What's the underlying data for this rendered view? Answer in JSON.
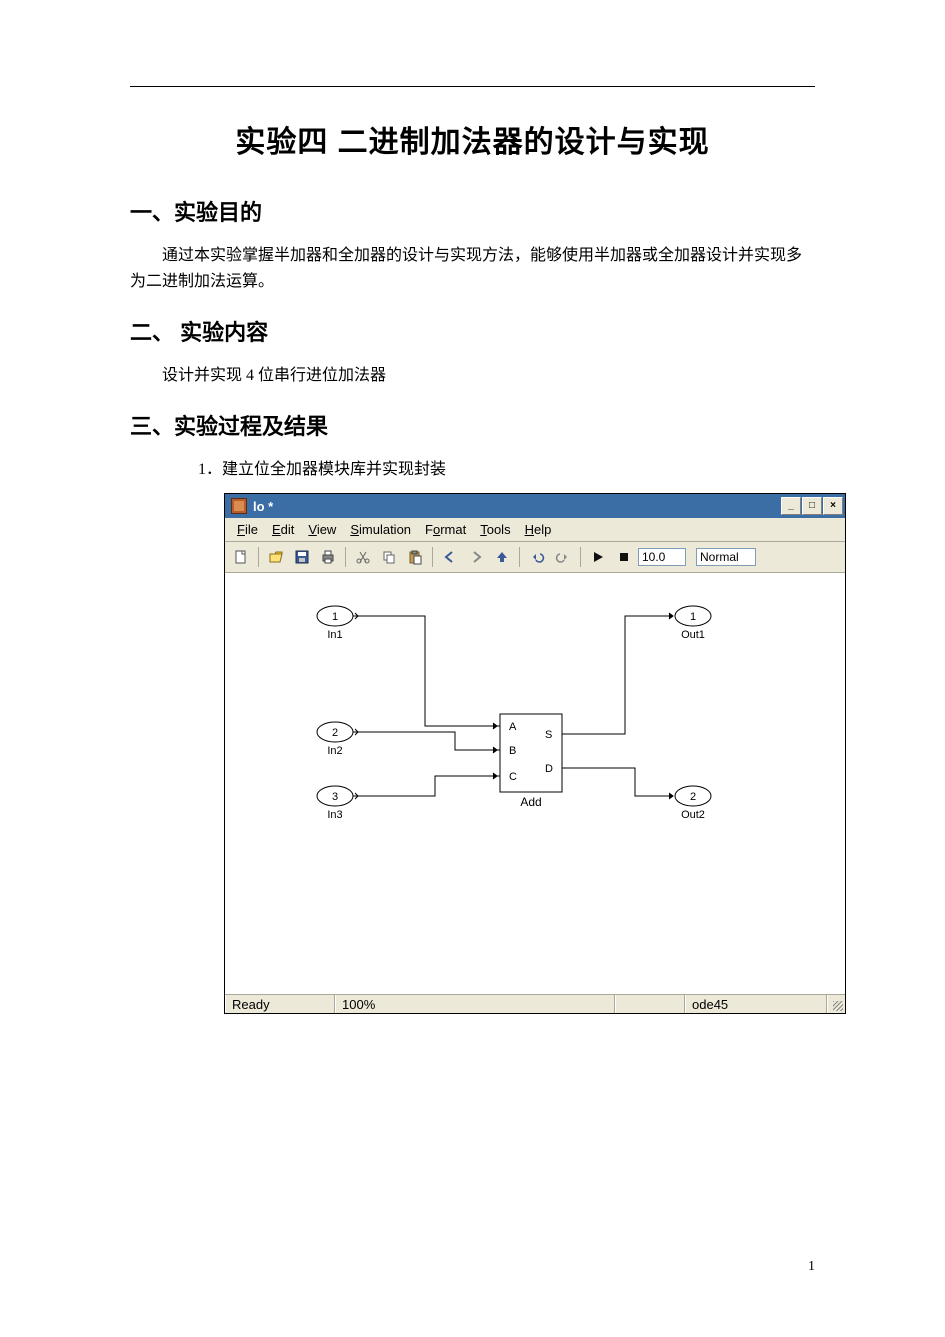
{
  "title": "实验四   二进制加法器的设计与实现",
  "s1": {
    "h": "一、实验目的",
    "p": "通过本实验掌握半加器和全加器的设计与实现方法，能够使用半加器或全加器设计并实现多为二进制加法运算。"
  },
  "s2": {
    "h": "二、 实验内容",
    "p": "设计并实现 4 位串行进位加法器"
  },
  "s3": {
    "h": "三、实验过程及结果",
    "step": "1．建立位全加器模块库并实现封装"
  },
  "win": {
    "title": "lo *",
    "btns": {
      "min": "_",
      "max": "□",
      "close": "×"
    },
    "menus": [
      "File",
      "Edit",
      "View",
      "Simulation",
      "Format",
      "Tools",
      "Help"
    ],
    "timeField": "10.0",
    "mode": "Normal",
    "status": {
      "ready": "Ready",
      "zoom": "100%",
      "solver": "ode45"
    }
  },
  "diagram": {
    "inputs": [
      {
        "num": "1",
        "label": "In1"
      },
      {
        "num": "2",
        "label": "In2"
      },
      {
        "num": "3",
        "label": "In3"
      }
    ],
    "outputs": [
      {
        "num": "1",
        "label": "Out1"
      },
      {
        "num": "2",
        "label": "Out2"
      }
    ],
    "block": {
      "name": "Add",
      "ports_in": [
        "A",
        "B",
        "C"
      ],
      "ports_out": [
        "S",
        "D"
      ]
    }
  },
  "pagenum": "1"
}
